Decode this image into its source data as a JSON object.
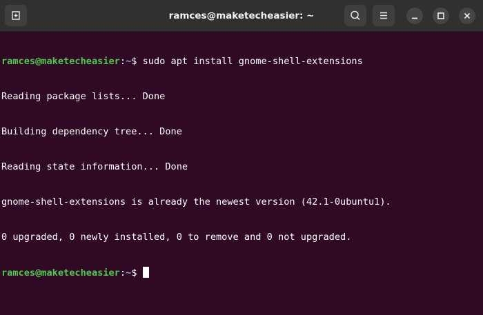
{
  "window": {
    "title": "ramces@maketecheasier: ~"
  },
  "colors": {
    "terminal_background": "#300a24",
    "titlebar_background": "#303030",
    "prompt_user": "#4ec94e",
    "prompt_path": "#8aa7d6",
    "text": "#ffffff"
  },
  "icons": {
    "new_tab": "new-tab-icon",
    "search": "search-icon",
    "menu": "hamburger-menu-icon",
    "minimize": "minimize-icon",
    "maximize": "maximize-icon",
    "close": "close-icon"
  },
  "terminal": {
    "first_prompt": {
      "user_host": "ramces@maketecheasier",
      "separator": ":",
      "path": "~",
      "symbol": "$",
      "command": " sudo apt install gnome-shell-extensions"
    },
    "output": [
      "Reading package lists... Done",
      "Building dependency tree... Done",
      "Reading state information... Done",
      "gnome-shell-extensions is already the newest version (42.1-0ubuntu1).",
      "0 upgraded, 0 newly installed, 0 to remove and 0 not upgraded."
    ],
    "second_prompt": {
      "user_host": "ramces@maketecheasier",
      "separator": ":",
      "path": "~",
      "symbol": "$ "
    }
  }
}
